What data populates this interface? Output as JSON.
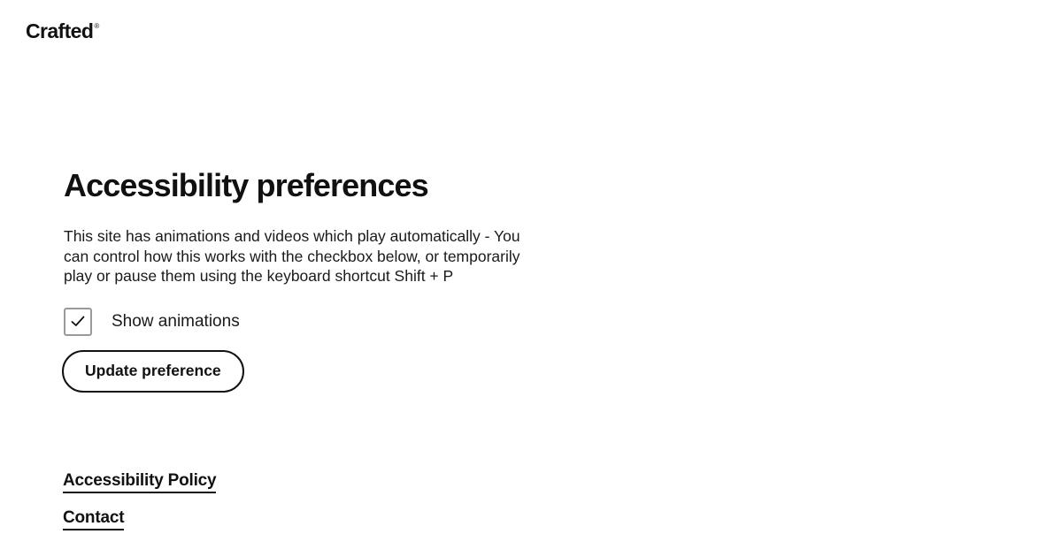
{
  "logo": {
    "name": "Crafted",
    "mark": "®"
  },
  "main": {
    "title": "Accessibility preferences",
    "description": "This site has animations and videos which play automatically - You can control how this works with the checkbox below, or temporarily play or pause them using the keyboard shortcut Shift + P",
    "checkbox": {
      "label": "Show animations",
      "checked": true
    },
    "update_button_label": "Update preference"
  },
  "footer": {
    "links": [
      {
        "label": "Accessibility Policy"
      },
      {
        "label": "Contact"
      }
    ]
  }
}
